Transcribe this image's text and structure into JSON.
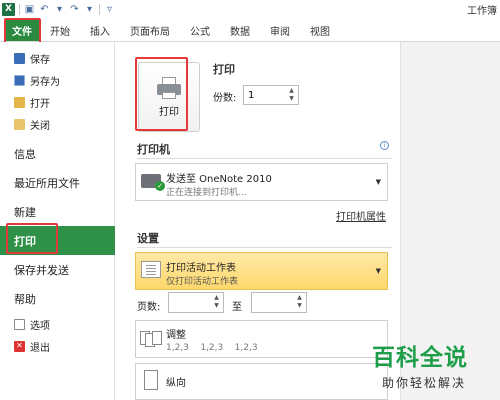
{
  "window": {
    "title": "工作簿"
  },
  "ribbon": {
    "tabs": [
      {
        "label": "文件"
      },
      {
        "label": "开始"
      },
      {
        "label": "插入"
      },
      {
        "label": "页面布局"
      },
      {
        "label": "公式"
      },
      {
        "label": "数据"
      },
      {
        "label": "审阅"
      },
      {
        "label": "视图"
      }
    ]
  },
  "nav": {
    "small_top": [
      {
        "label": "保存"
      },
      {
        "label": "另存为"
      },
      {
        "label": "打开"
      },
      {
        "label": "关闭"
      }
    ],
    "big": [
      {
        "label": "信息"
      },
      {
        "label": "最近所用文件"
      },
      {
        "label": "新建"
      },
      {
        "label": "打印"
      },
      {
        "label": "保存并发送"
      },
      {
        "label": "帮助"
      }
    ],
    "small_bottom": [
      {
        "label": "选项"
      },
      {
        "label": "退出"
      }
    ]
  },
  "print": {
    "button_label": "打印",
    "title": "打印",
    "copies_label": "份数:",
    "copies_value": "1"
  },
  "printer": {
    "section_title": "打印机",
    "name": "发送至 OneNote 2010",
    "status": "正在连接到打印机...",
    "properties_link": "打印机属性"
  },
  "settings": {
    "section_title": "设置",
    "print_what_main": "打印活动工作表",
    "print_what_sub": "仅打印活动工作表",
    "pages_label": "页数:",
    "pages_to": "至",
    "collate_main": "调整",
    "collate_sub": "1,2,3    1,2,3    1,2,3",
    "orientation_main": "纵向"
  },
  "watermark": {
    "logo": "百科全说",
    "sub": "助你轻松解决"
  },
  "colors": {
    "file_tab": "#2a8a3f",
    "nav_active": "#2f9148",
    "highlight_dropdown": "#ffd86b",
    "annotation_red": "#e23a3a",
    "watermark_green": "#1f9e4a"
  }
}
